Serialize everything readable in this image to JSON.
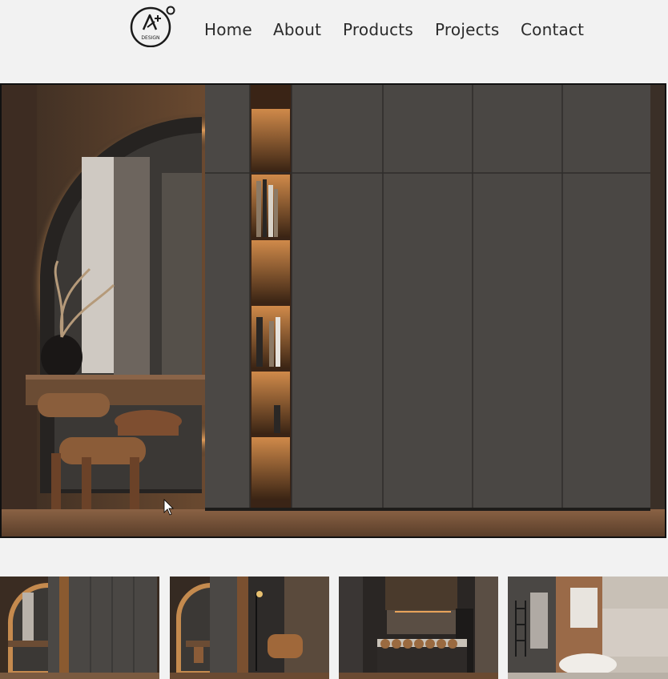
{
  "nav": {
    "logo_text": "DESIGN",
    "items": [
      {
        "label": "Home"
      },
      {
        "label": "About"
      },
      {
        "label": "Products"
      },
      {
        "label": "Projects"
      },
      {
        "label": "Contact"
      }
    ]
  },
  "hero": {
    "image": "bedroom-wardrobe-with-arched-mirror"
  },
  "thumbnails": [
    {
      "image": "wardrobe-arched-mirror"
    },
    {
      "image": "wardrobe-lounge-chair"
    },
    {
      "image": "dark-kitchen-island"
    },
    {
      "image": "bathroom-bathtub"
    }
  ],
  "colors": {
    "background": "#f2f2f2",
    "nav_text": "#2b2b2b",
    "wardrobe": "#4a4744",
    "wood": "#5a3a22",
    "glow": "#e8a35a"
  }
}
